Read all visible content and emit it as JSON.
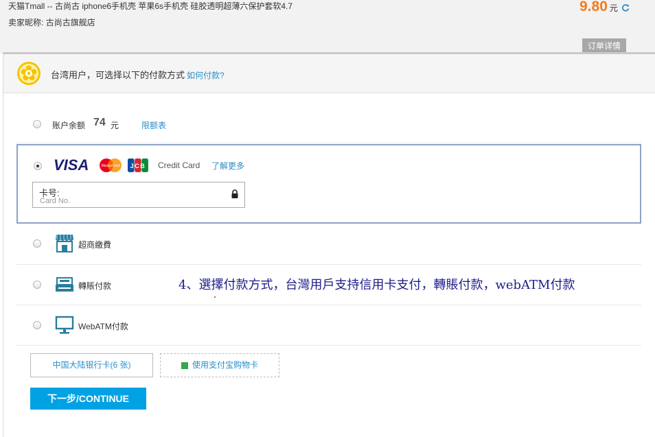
{
  "order": {
    "title": "天猫Tmall -- 古尚古 iphone6手机壳 苹果6s手机壳 硅胶透明超薄六保护套软4.7",
    "seller_label": "卖家昵称:",
    "seller_name": "古尚古旗舰店",
    "amount": "9.80",
    "amount_unit": "元",
    "detail_tab": "订单详情"
  },
  "notice": {
    "text": "台湾用户，可选择以下的付款方式",
    "how_link": "如何付款?"
  },
  "balance": {
    "label": "账户余额",
    "amount": "74",
    "unit": "元",
    "limit_link": "限额表"
  },
  "credit_card": {
    "label": "Credit Card",
    "learn_more": "了解更多",
    "field_label": "卡号:",
    "field_placeholder": "Card No.",
    "brand_visa": "VISA",
    "brand_mastercard": "MasterCard",
    "brand_jcb": "JCB"
  },
  "methods": [
    {
      "label": "超商繳費",
      "icon": "store-icon"
    },
    {
      "label": "轉賬付款",
      "icon": "bank-transfer-icon"
    },
    {
      "label": "WebATM付款",
      "icon": "monitor-icon"
    }
  ],
  "annotation": "4、選擇付款方式，台灣用戶支持信用卡支付，轉賬付款，webATM付款",
  "buttons": {
    "mainland_card": "中国大陆银行卡(6 张)",
    "giftcard": "使用支付宝购物卡",
    "next": "下一步/CONTINUE"
  },
  "colors": {
    "accent_blue": "#00a2e4",
    "link_blue": "#2a8ec8",
    "amount_orange": "#f37b1d",
    "selected_border": "#8da1c6"
  }
}
